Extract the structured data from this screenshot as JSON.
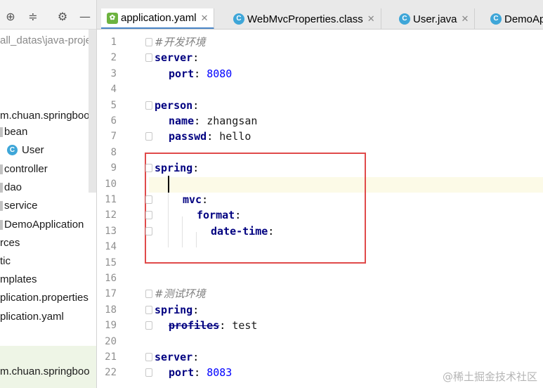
{
  "project_panel": {
    "path_fragment": "all_datas\\java-proje",
    "items": [
      {
        "label": "m.chuan.springboo",
        "type": "package"
      },
      {
        "label": "bean",
        "type": "package"
      },
      {
        "label": "User",
        "type": "class",
        "icon": "class-icon"
      },
      {
        "label": "controller",
        "type": "package"
      },
      {
        "label": "dao",
        "type": "package"
      },
      {
        "label": "service",
        "type": "package"
      },
      {
        "label": "DemoApplication",
        "type": "class"
      },
      {
        "label": "rces",
        "type": "folder"
      },
      {
        "label": "tic",
        "type": "folder"
      },
      {
        "label": "mplates",
        "type": "folder"
      },
      {
        "label": "plication.properties",
        "type": "file"
      },
      {
        "label": "plication.yaml",
        "type": "file"
      },
      {
        "label": "m.chuan.springboo",
        "type": "package"
      }
    ],
    "toolbar_icons": [
      "crosshair-icon",
      "collapse-icon",
      "gear-icon",
      "minimize-icon"
    ]
  },
  "tabs": [
    {
      "label": "application.yaml",
      "icon": "yaml-icon",
      "active": true,
      "closable": true
    },
    {
      "label": "WebMvcProperties.class",
      "icon": "class-icon",
      "active": false,
      "closable": true
    },
    {
      "label": "User.java",
      "icon": "class-icon",
      "active": false,
      "closable": true
    },
    {
      "label": "DemoAp",
      "icon": "class-icon",
      "active": false,
      "closable": false
    }
  ],
  "editor": {
    "line_numbers": [
      "1",
      "2",
      "3",
      "4",
      "5",
      "6",
      "7",
      "8",
      "9",
      "10",
      "11",
      "12",
      "13",
      "14",
      "15",
      "16",
      "17",
      "18",
      "19",
      "20",
      "21",
      "22"
    ],
    "lines": [
      {
        "n": 1,
        "comment": "#开发环境"
      },
      {
        "n": 2,
        "key": "server",
        "sep": ":"
      },
      {
        "n": 3,
        "key": "port",
        "sep": ": ",
        "value": "8080",
        "value_kind": "number"
      },
      {
        "n": 4
      },
      {
        "n": 5,
        "key": "person",
        "sep": ":"
      },
      {
        "n": 6,
        "key": "name",
        "sep": ": ",
        "value": "zhangsan"
      },
      {
        "n": 7,
        "key": "passwd",
        "sep": ": ",
        "value": "hello"
      },
      {
        "n": 8
      },
      {
        "n": 9,
        "key": "spring",
        "sep": ":"
      },
      {
        "n": 10
      },
      {
        "n": 11,
        "key": "mvc",
        "sep": ":"
      },
      {
        "n": 12,
        "key": "format",
        "sep": ":"
      },
      {
        "n": 13,
        "key": "date-time",
        "sep": ":"
      },
      {
        "n": 14
      },
      {
        "n": 15
      },
      {
        "n": 16
      },
      {
        "n": 17,
        "comment": "#测试环境"
      },
      {
        "n": 18,
        "key": "spring",
        "sep": ":"
      },
      {
        "n": 19,
        "key": "profiles",
        "sep": ": ",
        "value": "test",
        "deprecated": true
      },
      {
        "n": 20
      },
      {
        "n": 21,
        "key": "server",
        "sep": ":"
      },
      {
        "n": 22,
        "key": "port",
        "sep": ": ",
        "value": "8083",
        "value_kind": "number"
      }
    ],
    "current_line": 10
  },
  "watermark": "@稀土掘金技术社区",
  "colors": {
    "key": "#000080",
    "number": "#0000ff",
    "comment": "#808080",
    "highlight_box": "#e04a4a",
    "active_tab_underline": "#4a86c8",
    "current_line_bg": "#fcfae7"
  }
}
